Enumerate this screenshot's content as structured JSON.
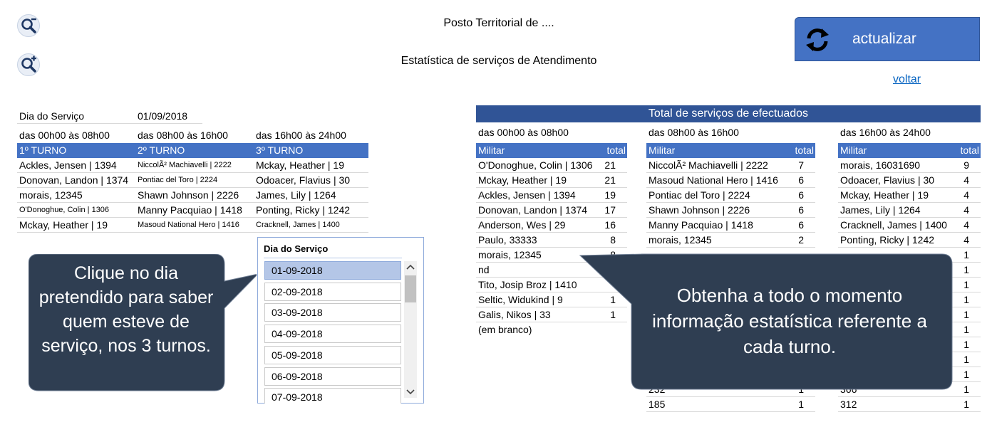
{
  "header": {
    "title_line1": "Posto Territorial de ....",
    "title_line2": "Estatística de serviços de Atendimento",
    "refresh_label": "actualizar",
    "back_link": "voltar",
    "zoom_out_icon": "zoom-out-icon",
    "zoom_in_icon": "zoom-in-icon"
  },
  "left_table": {
    "day_label": "Dia do Serviço",
    "day_value": "01/09/2018",
    "shift_ranges": [
      "das 00h00 às 08h00",
      "das 08h00 às 16h00",
      "das 16h00 às 24h00"
    ],
    "shift_headers": [
      "1º TURNO",
      "2º TURNO",
      "3º TURNO"
    ],
    "rows": [
      [
        "Ackles, Jensen | 1394",
        "NiccolÃ² Machiavelli | 2222",
        "Mckay, Heather | 19"
      ],
      [
        "Donovan, Landon | 1374",
        "Pontiac del Toro | 2224",
        "Odoacer, Flavius | 30"
      ],
      [
        "morais, 12345",
        "Shawn Johnson | 2226",
        "James, Lily | 1264"
      ],
      [
        "O'Donoghue, Colin | 1306",
        "Manny Pacquiao | 1418",
        "Ponting, Ricky | 1242"
      ],
      [
        "Mckay, Heather | 19",
        "Masoud National Hero | 1416",
        "Cracknell, James | 1400"
      ]
    ]
  },
  "slicer": {
    "title": "Dia do Serviço",
    "items": [
      "01-09-2018",
      "02-09-2018",
      "03-09-2018",
      "04-09-2018",
      "05-09-2018",
      "06-09-2018",
      "07-09-2018"
    ],
    "selected_index": 0
  },
  "stats": {
    "banner": "Total de serviços de efectuados",
    "tables": [
      {
        "range": "das 00h00 às 08h00",
        "col_militar": "Militar",
        "col_total": "total",
        "rows": [
          [
            "O'Donoghue, Colin | 1306",
            "21"
          ],
          [
            "Mckay, Heather | 19",
            "21"
          ],
          [
            "Ackles, Jensen | 1394",
            "19"
          ],
          [
            "Donovan, Landon | 1374",
            "17"
          ],
          [
            "Anderson, Wes | 29",
            "16"
          ],
          [
            "Paulo, 33333",
            "8"
          ],
          [
            "morais, 12345",
            "8"
          ],
          [
            "nd",
            ""
          ],
          [
            "Tito, Josip Broz | 1410",
            ""
          ],
          [
            "Seltic, Widukind | 9",
            "1"
          ],
          [
            "Galis, Nikos | 33",
            "1"
          ],
          [
            "(em branco)",
            ""
          ]
        ]
      },
      {
        "range": "das 08h00 às 16h00",
        "col_militar": "Militar",
        "col_total": "total",
        "rows": [
          [
            "NiccolÃ² Machiavelli | 2222",
            "7"
          ],
          [
            "Masoud National Hero | 1416",
            "6"
          ],
          [
            "Pontiac del Toro | 2224",
            "6"
          ],
          [
            "Shawn Johnson | 2226",
            "6"
          ],
          [
            "Manny Pacquiao | 1418",
            "6"
          ],
          [
            "morais, 12345",
            "2"
          ],
          [
            "",
            ""
          ],
          [
            "",
            ""
          ],
          [
            "",
            ""
          ],
          [
            "",
            ""
          ],
          [
            "",
            ""
          ],
          [
            "",
            ""
          ],
          [
            "",
            ""
          ],
          [
            "",
            ""
          ],
          [
            "",
            ""
          ],
          [
            "232",
            "1"
          ],
          [
            "185",
            "1"
          ]
        ]
      },
      {
        "range": "das 16h00 às 24h00",
        "col_militar": "Militar",
        "col_total": "total",
        "rows": [
          [
            "morais, 16031690",
            "9"
          ],
          [
            "Odoacer, Flavius | 30",
            "4"
          ],
          [
            "Mckay, Heather | 19",
            "4"
          ],
          [
            "James, Lily | 1264",
            "4"
          ],
          [
            "Cracknell, James | 1400",
            "4"
          ],
          [
            "Ponting, Ricky | 1242",
            "4"
          ],
          [
            "",
            "1"
          ],
          [
            "",
            "1"
          ],
          [
            "",
            "1"
          ],
          [
            "",
            "1"
          ],
          [
            "",
            "1"
          ],
          [
            "",
            "1"
          ],
          [
            "",
            "1"
          ],
          [
            "",
            "1"
          ],
          [
            "",
            "1"
          ],
          [
            "366",
            "1"
          ],
          [
            "312",
            "1"
          ]
        ]
      }
    ]
  },
  "callouts": {
    "left": "Clique no dia pretendido para saber quem esteve de serviço, nos 3 turnos.",
    "right": "Obtenha a todo o momento informação estatística referente a cada turno."
  }
}
